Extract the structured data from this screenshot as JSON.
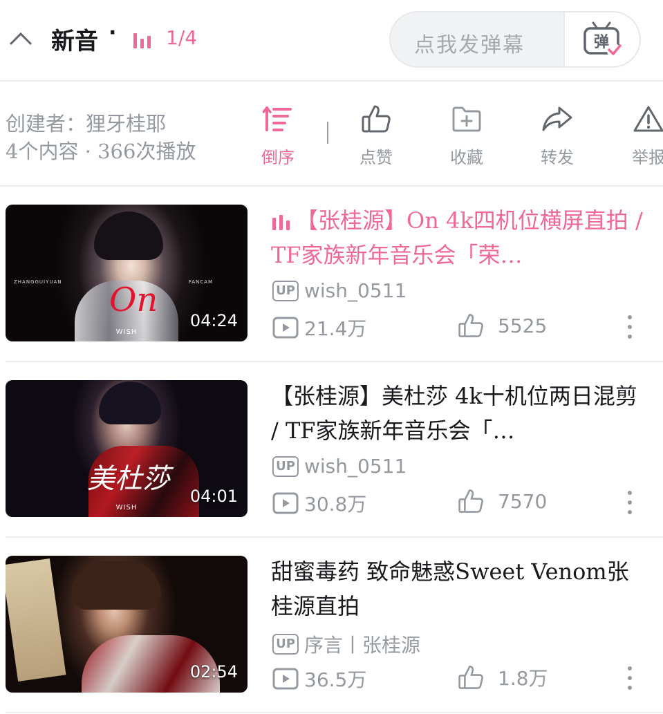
{
  "header": {
    "title": "新音",
    "dot": "·",
    "page_indicator": "1/4",
    "danmaku_placeholder": "点我发弹幕",
    "danmaku_button_icon": "danmaku-toggle-icon",
    "accent_color": "#f0679a"
  },
  "info": {
    "creator": "创建者：狸牙桂耶",
    "stats": "4个内容 · 366次播放",
    "actions": [
      {
        "label": "倒序",
        "icon": "sort-reverse-icon"
      },
      {
        "label": "点赞",
        "icon": "thumbs-up-icon"
      },
      {
        "label": "收藏",
        "icon": "folder-add-icon"
      },
      {
        "label": "转发",
        "icon": "share-arrow-icon"
      },
      {
        "label": "举报",
        "icon": "warning-icon"
      }
    ]
  },
  "videos": [
    {
      "title": "【张桂源】On 4k四机位横屏直拍 / TF家族新年音乐会「荣…",
      "playing": true,
      "uploader": "wish_0511",
      "up_badge": "UP",
      "plays": "21.4万",
      "likes": "5525",
      "duration": "04:24",
      "thumb_word": "On",
      "thumb_brand": "WISH",
      "thumb_side_left": "ZHANGGUIYUAN",
      "thumb_side_right": "FANCAM"
    },
    {
      "title": "【张桂源】美杜莎 4k十机位两日混剪 / TF家族新年音乐会「…",
      "playing": false,
      "uploader": "wish_0511",
      "up_badge": "UP",
      "plays": "30.8万",
      "likes": "7570",
      "duration": "04:01",
      "thumb_word": "美杜莎",
      "thumb_brand": "WISH"
    },
    {
      "title": "甜蜜毒药 致命魅惑Sweet Venom张桂源直拍",
      "playing": false,
      "uploader": "序言丨张桂源",
      "up_badge": "UP",
      "plays": "36.5万",
      "likes": "1.8万",
      "duration": "02:54"
    }
  ]
}
